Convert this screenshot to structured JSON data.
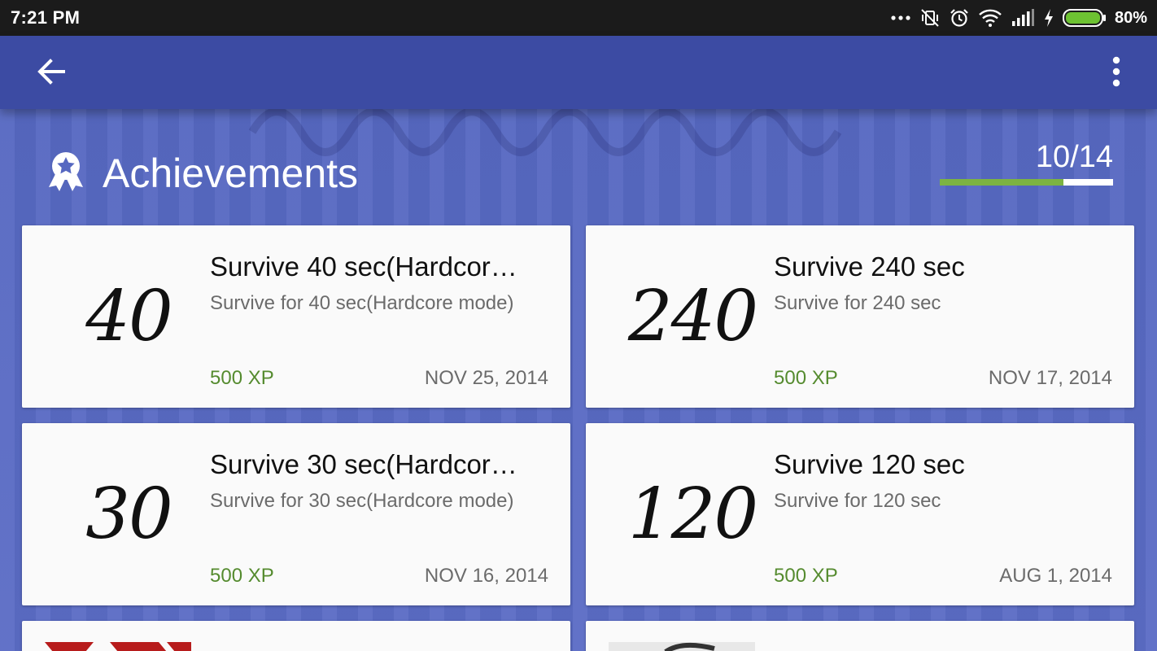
{
  "status_bar": {
    "time": "7:21 PM",
    "battery": "80%"
  },
  "achievements": {
    "title": "Achievements",
    "progress": "10/14",
    "unlocked": 10,
    "total": 14
  },
  "cards": [
    {
      "art": "40",
      "name": "Survive 40 sec(Hardcor…",
      "description": "Survive for 40 sec(Hardcore mode)",
      "xp": "500 XP",
      "date": "NOV 25, 2014"
    },
    {
      "art": "240",
      "name": "Survive 240 sec",
      "description": "Survive for  240 sec",
      "xp": "500 XP",
      "date": "NOV 17, 2014"
    },
    {
      "art": "30",
      "name": "Survive 30 sec(Hardcor…",
      "description": "Survive for 30 sec(Hardcore mode)",
      "xp": "500 XP",
      "date": "NOV 16, 2014"
    },
    {
      "art": "120",
      "name": "Survive 120 sec",
      "description": "Survive for  120 sec",
      "xp": "500 XP",
      "date": "AUG 1, 2014"
    }
  ],
  "icons": [
    "back-arrow-icon",
    "more-vert-icon",
    "achievement-badge-icon",
    "wifi-icon",
    "signal-icon",
    "battery-icon",
    "alarm-icon",
    "vibrate-off-icon"
  ],
  "colors": {
    "appbar": "#3c4ba3",
    "xp": "#558b2f",
    "progress": "#7cb342"
  }
}
